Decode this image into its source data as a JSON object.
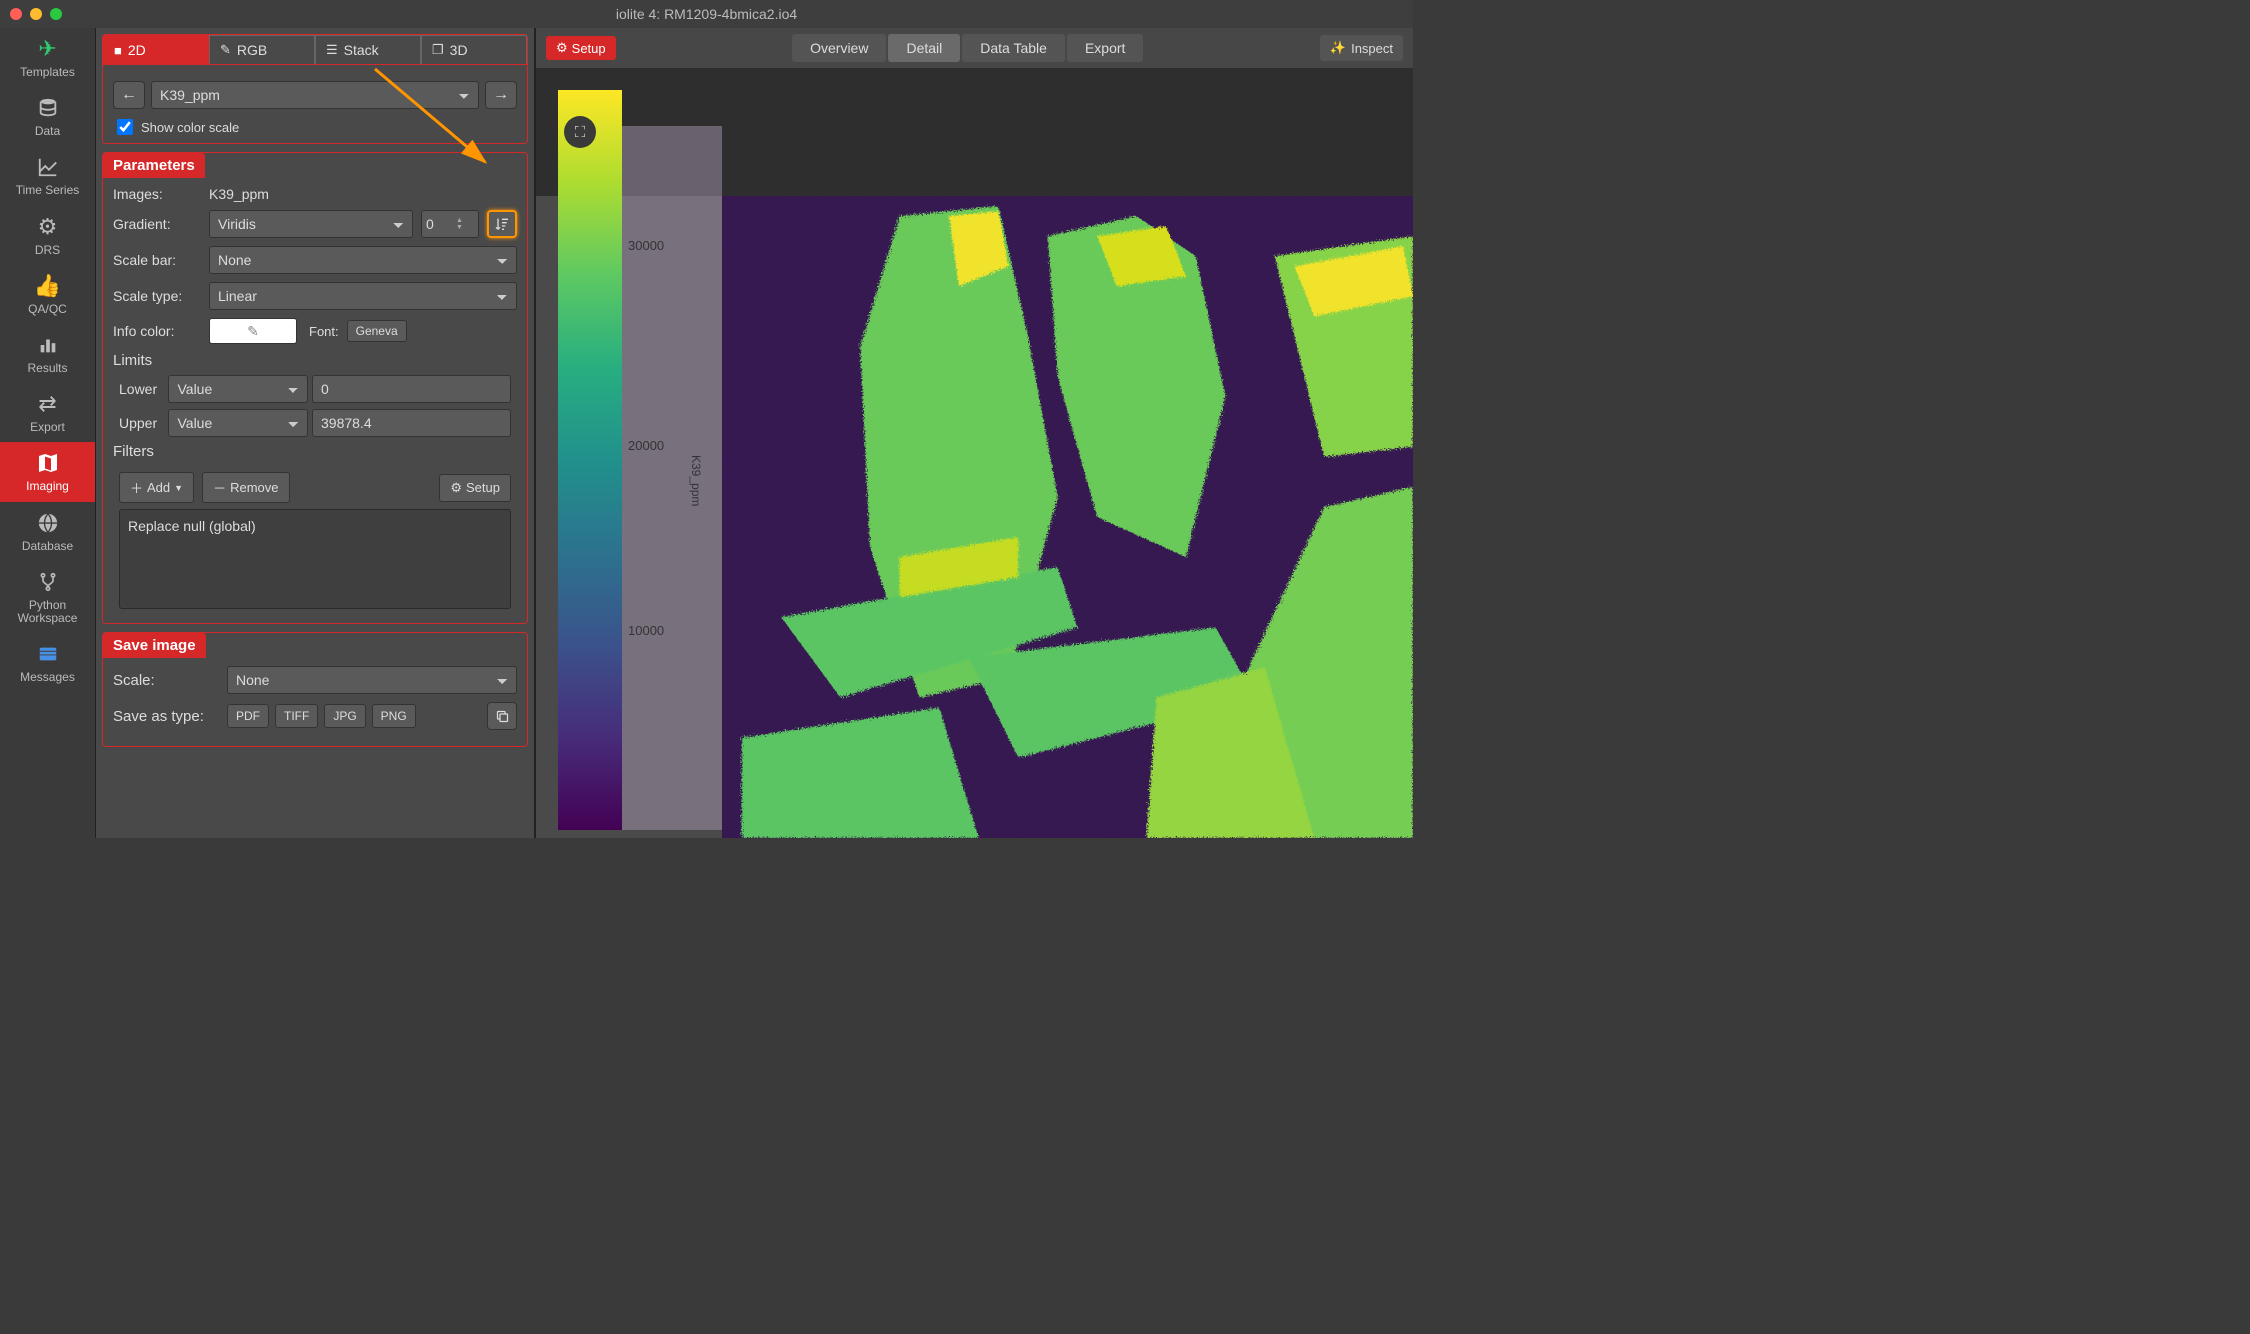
{
  "window": {
    "title": "iolite 4: RM1209-4bmica2.io4"
  },
  "sidebar": {
    "items": [
      {
        "label": "Templates"
      },
      {
        "label": "Data"
      },
      {
        "label": "Time Series"
      },
      {
        "label": "DRS"
      },
      {
        "label": "QA/QC"
      },
      {
        "label": "Results"
      },
      {
        "label": "Export"
      },
      {
        "label": "Imaging"
      },
      {
        "label": "Database"
      },
      {
        "label": "Python\nWorkspace"
      },
      {
        "label": "Messages"
      }
    ]
  },
  "view_tabs": {
    "items": [
      {
        "label": "2D"
      },
      {
        "label": "RGB"
      },
      {
        "label": "Stack"
      },
      {
        "label": "3D"
      }
    ]
  },
  "channel": {
    "selected": "K39_ppm"
  },
  "show_color_scale": {
    "label": "Show color scale"
  },
  "parameters": {
    "header": "Parameters",
    "images_label": "Images:",
    "images_value": "K39_ppm",
    "gradient_label": "Gradient:",
    "gradient_value": "Viridis",
    "gradient_number": "0",
    "scalebar_label": "Scale bar:",
    "scalebar_value": "None",
    "scaletype_label": "Scale type:",
    "scaletype_value": "Linear",
    "infocolor_label": "Info color:",
    "font_label": "Font:",
    "font_value": "Geneva"
  },
  "limits": {
    "header": "Limits",
    "lower_label": "Lower",
    "lower_mode": "Value",
    "lower_value": "0",
    "upper_label": "Upper",
    "upper_mode": "Value",
    "upper_value": "39878.4"
  },
  "filters": {
    "header": "Filters",
    "add_label": "Add",
    "remove_label": "Remove",
    "setup_label": "Setup",
    "items": [
      "Replace null (global)"
    ]
  },
  "save_image": {
    "header": "Save image",
    "scale_label": "Scale:",
    "scale_value": "None",
    "save_as_label": "Save as type:",
    "formats": [
      "PDF",
      "TIFF",
      "JPG",
      "PNG"
    ]
  },
  "right": {
    "setup_label": "Setup",
    "tabs": [
      "Overview",
      "Detail",
      "Data Table",
      "Export"
    ],
    "active_tab": "Detail",
    "inspect_label": "Inspect"
  },
  "colorbar": {
    "axis_label": "K39_ppm",
    "ticks": [
      {
        "value": "30000",
        "pct": 24
      },
      {
        "value": "20000",
        "pct": 50
      },
      {
        "value": "10000",
        "pct": 75
      }
    ]
  }
}
